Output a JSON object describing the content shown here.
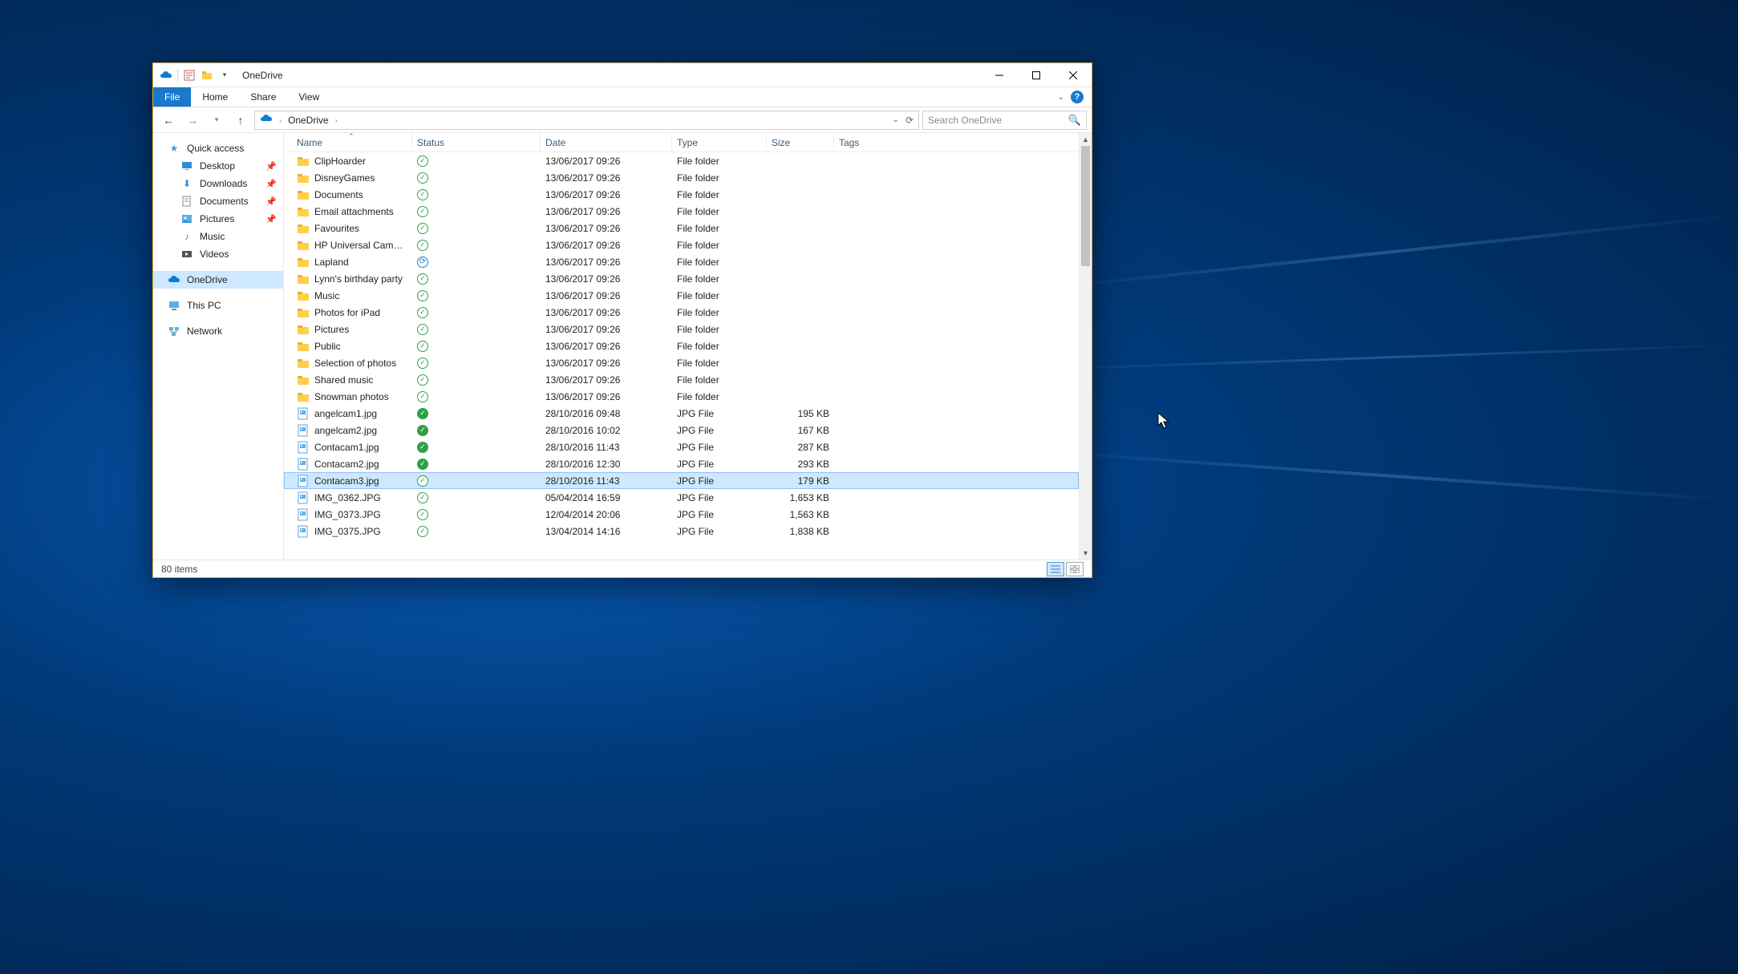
{
  "window": {
    "title": "OneDrive"
  },
  "ribbon": {
    "file": "File",
    "home": "Home",
    "share": "Share",
    "view": "View"
  },
  "address": {
    "location": "OneDrive",
    "search_placeholder": "Search OneDrive"
  },
  "sidebar": {
    "quick_access": "Quick access",
    "desktop": "Desktop",
    "downloads": "Downloads",
    "documents": "Documents",
    "pictures": "Pictures",
    "music": "Music",
    "videos": "Videos",
    "onedrive": "OneDrive",
    "this_pc": "This PC",
    "network": "Network"
  },
  "columns": {
    "name": "Name",
    "status": "Status",
    "date": "Date",
    "type": "Type",
    "size": "Size",
    "tags": "Tags"
  },
  "rows": [
    {
      "icon": "folder",
      "name": "ClipHoarder",
      "status": "green-out",
      "date": "13/06/2017 09:26",
      "type": "File folder",
      "size": ""
    },
    {
      "icon": "folder",
      "name": "DisneyGames",
      "status": "green-out",
      "date": "13/06/2017 09:26",
      "type": "File folder",
      "size": ""
    },
    {
      "icon": "folder",
      "name": "Documents",
      "status": "green-out",
      "date": "13/06/2017 09:26",
      "type": "File folder",
      "size": ""
    },
    {
      "icon": "folder",
      "name": "Email attachments",
      "status": "green-out",
      "date": "13/06/2017 09:26",
      "type": "File folder",
      "size": ""
    },
    {
      "icon": "folder",
      "name": "Favourites",
      "status": "green-out",
      "date": "13/06/2017 09:26",
      "type": "File folder",
      "size": ""
    },
    {
      "icon": "folder",
      "name": "HP Universal Camer...",
      "status": "green-out",
      "date": "13/06/2017 09:26",
      "type": "File folder",
      "size": ""
    },
    {
      "icon": "folder",
      "name": "Lapland",
      "status": "sync",
      "date": "13/06/2017 09:26",
      "type": "File folder",
      "size": ""
    },
    {
      "icon": "folder",
      "name": "Lynn's birthday party",
      "status": "green-out",
      "date": "13/06/2017 09:26",
      "type": "File folder",
      "size": ""
    },
    {
      "icon": "folder",
      "name": "Music",
      "status": "green-out",
      "date": "13/06/2017 09:26",
      "type": "File folder",
      "size": ""
    },
    {
      "icon": "folder",
      "name": "Photos for iPad",
      "status": "green-out",
      "date": "13/06/2017 09:26",
      "type": "File folder",
      "size": ""
    },
    {
      "icon": "folder",
      "name": "Pictures",
      "status": "green-out",
      "date": "13/06/2017 09:26",
      "type": "File folder",
      "size": ""
    },
    {
      "icon": "folder",
      "name": "Public",
      "status": "green-out",
      "date": "13/06/2017 09:26",
      "type": "File folder",
      "size": ""
    },
    {
      "icon": "folder",
      "name": "Selection of photos",
      "status": "green-out",
      "date": "13/06/2017 09:26",
      "type": "File folder",
      "size": ""
    },
    {
      "icon": "folder",
      "name": "Shared music",
      "status": "green-out",
      "date": "13/06/2017 09:26",
      "type": "File folder",
      "size": ""
    },
    {
      "icon": "folder",
      "name": "Snowman photos",
      "status": "green-out",
      "date": "13/06/2017 09:26",
      "type": "File folder",
      "size": ""
    },
    {
      "icon": "jpg",
      "name": "angelcam1.jpg",
      "status": "green-fill",
      "date": "28/10/2016 09:48",
      "type": "JPG File",
      "size": "195 KB"
    },
    {
      "icon": "jpg",
      "name": "angelcam2.jpg",
      "status": "green-fill",
      "date": "28/10/2016 10:02",
      "type": "JPG File",
      "size": "167 KB"
    },
    {
      "icon": "jpg",
      "name": "Contacam1.jpg",
      "status": "green-fill",
      "date": "28/10/2016 11:43",
      "type": "JPG File",
      "size": "287 KB"
    },
    {
      "icon": "jpg",
      "name": "Contacam2.jpg",
      "status": "green-fill",
      "date": "28/10/2016 12:30",
      "type": "JPG File",
      "size": "293 KB"
    },
    {
      "icon": "jpg",
      "name": "Contacam3.jpg",
      "status": "green-out",
      "date": "28/10/2016 11:43",
      "type": "JPG File",
      "size": "179 KB",
      "selected": true
    },
    {
      "icon": "jpg",
      "name": "IMG_0362.JPG",
      "status": "green-out",
      "date": "05/04/2014 16:59",
      "type": "JPG File",
      "size": "1,653 KB"
    },
    {
      "icon": "jpg",
      "name": "IMG_0373.JPG",
      "status": "green-out",
      "date": "12/04/2014 20:06",
      "type": "JPG File",
      "size": "1,563 KB"
    },
    {
      "icon": "jpg",
      "name": "IMG_0375.JPG",
      "status": "green-out",
      "date": "13/04/2014 14:16",
      "type": "JPG File",
      "size": "1,838 KB"
    }
  ],
  "statusbar": {
    "count": "80 items"
  }
}
